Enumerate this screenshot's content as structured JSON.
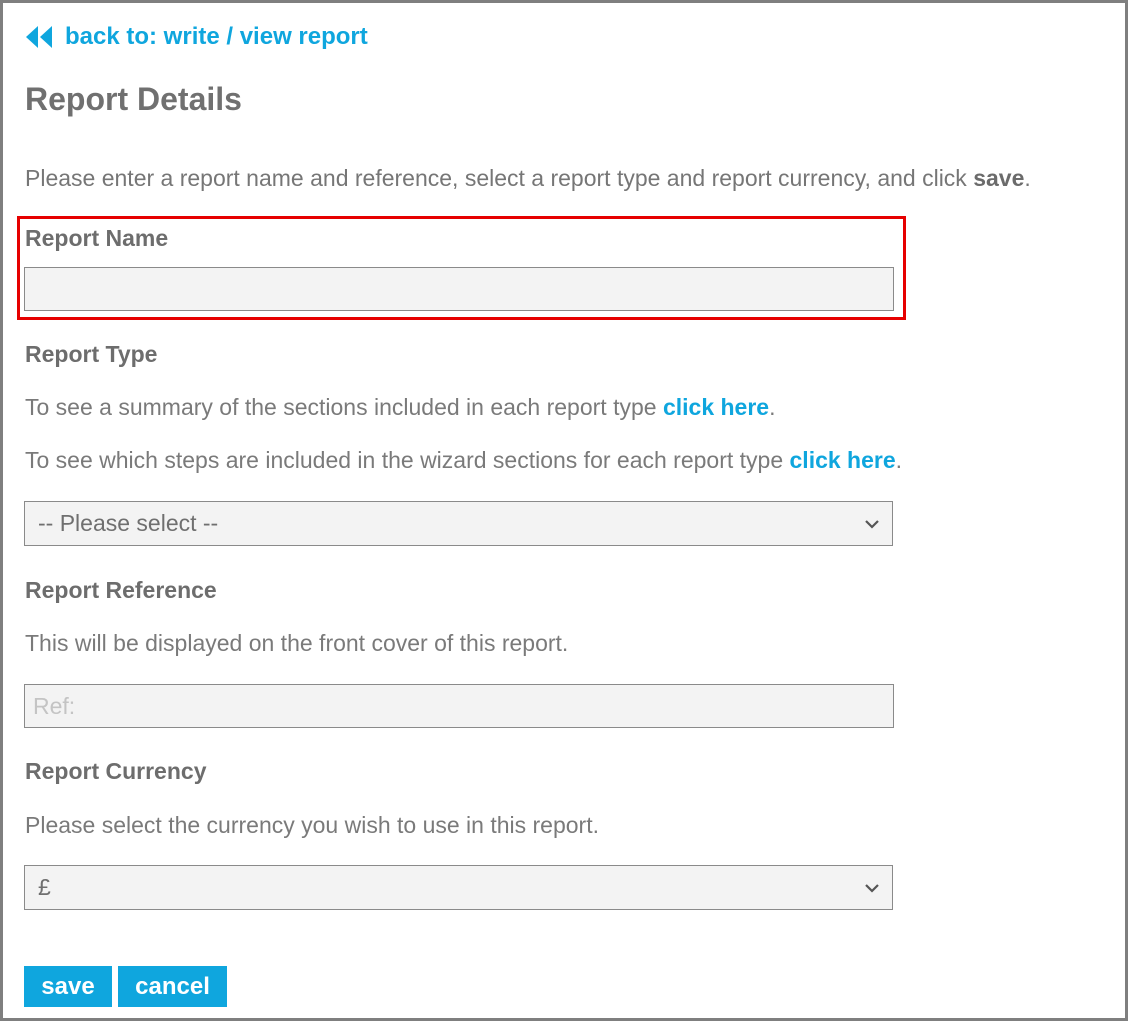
{
  "nav": {
    "back_label": "back to: write / view report"
  },
  "page": {
    "title": "Report Details",
    "intro_text": "Please enter a report name and reference, select a report type and report currency, and click ",
    "intro_bold": "save",
    "intro_end": "."
  },
  "report_name": {
    "label": "Report Name",
    "value": ""
  },
  "report_type": {
    "label": "Report Type",
    "summary_text": "To see a summary of the sections included in each report type ",
    "summary_link": "click here",
    "summary_end": ".",
    "wizard_text": "To see which steps are included in the wizard sections for each report type ",
    "wizard_link": "click here",
    "wizard_end": ".",
    "selected": "-- Please select --"
  },
  "report_reference": {
    "label": "Report Reference",
    "help": "This will be displayed on the front cover of this report.",
    "placeholder": "Ref:"
  },
  "report_currency": {
    "label": "Report Currency",
    "help": "Please select the currency you wish to use in this report.",
    "selected": "£"
  },
  "actions": {
    "save_label": "save",
    "cancel_label": "cancel"
  },
  "colors": {
    "accent": "#0fa6de",
    "highlight": "#e60000",
    "field_bg": "#f3f3f3"
  },
  "icons": {
    "back": "double-chevron-left-icon",
    "dropdown": "chevron-down-icon"
  }
}
